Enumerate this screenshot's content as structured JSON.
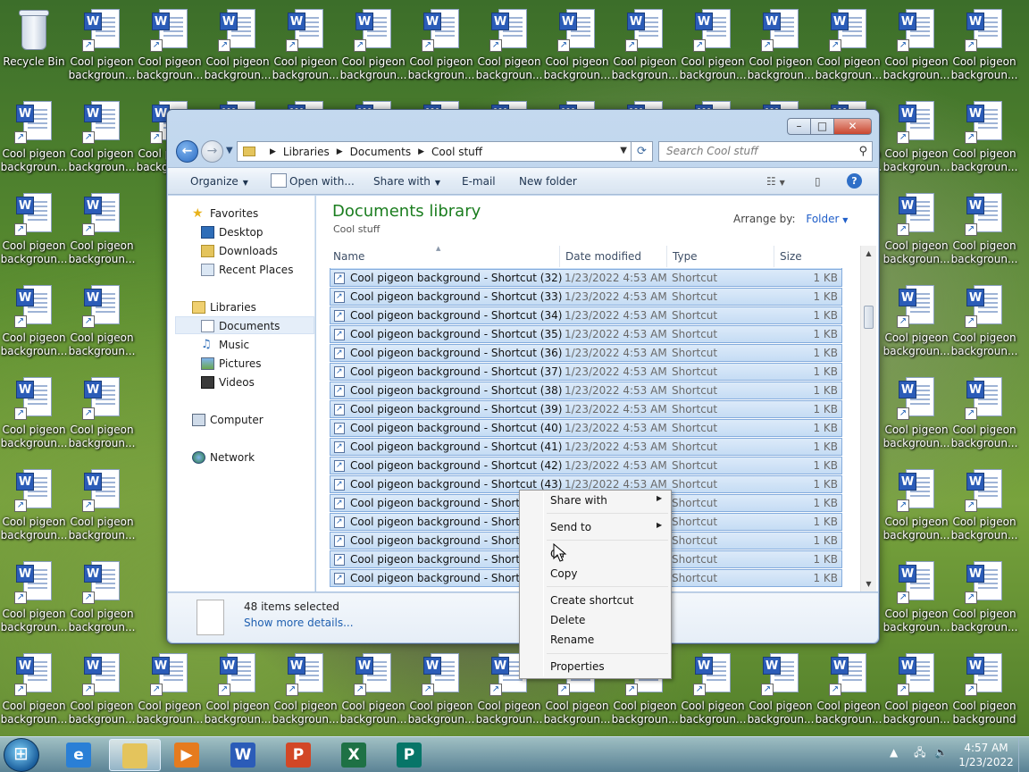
{
  "desktop": {
    "recycle_bin_label": "Recycle Bin",
    "icon_label_line1": "Cool pigeon",
    "icon_label_line2": "backgroun...",
    "last_icon_line2": "background"
  },
  "window": {
    "breadcrumb": [
      "Libraries",
      "Documents",
      "Cool stuff"
    ],
    "search_placeholder": "Search Cool stuff",
    "toolbar": {
      "organize": "Organize",
      "open_with": "Open with...",
      "share_with": "Share with",
      "email": "E-mail",
      "new_folder": "New folder"
    },
    "nav": {
      "favorites": "Favorites",
      "desktop": "Desktop",
      "downloads": "Downloads",
      "recent_places": "Recent Places",
      "libraries": "Libraries",
      "documents": "Documents",
      "music": "Music",
      "pictures": "Pictures",
      "videos": "Videos",
      "computer": "Computer",
      "network": "Network"
    },
    "library_title": "Documents library",
    "library_subtitle": "Cool stuff",
    "arrange_by_label": "Arrange by:",
    "arrange_by_value": "Folder",
    "columns": {
      "name": "Name",
      "date": "Date modified",
      "type": "Type",
      "size": "Size"
    },
    "files": [
      {
        "name": "Cool pigeon background - Shortcut (32)",
        "date": "1/23/2022 4:53 AM",
        "type": "Shortcut",
        "size": "1 KB"
      },
      {
        "name": "Cool pigeon background - Shortcut (33)",
        "date": "1/23/2022 4:53 AM",
        "type": "Shortcut",
        "size": "1 KB"
      },
      {
        "name": "Cool pigeon background - Shortcut (34)",
        "date": "1/23/2022 4:53 AM",
        "type": "Shortcut",
        "size": "1 KB"
      },
      {
        "name": "Cool pigeon background - Shortcut (35)",
        "date": "1/23/2022 4:53 AM",
        "type": "Shortcut",
        "size": "1 KB"
      },
      {
        "name": "Cool pigeon background - Shortcut (36)",
        "date": "1/23/2022 4:53 AM",
        "type": "Shortcut",
        "size": "1 KB"
      },
      {
        "name": "Cool pigeon background - Shortcut (37)",
        "date": "1/23/2022 4:53 AM",
        "type": "Shortcut",
        "size": "1 KB"
      },
      {
        "name": "Cool pigeon background - Shortcut (38)",
        "date": "1/23/2022 4:53 AM",
        "type": "Shortcut",
        "size": "1 KB"
      },
      {
        "name": "Cool pigeon background - Shortcut (39)",
        "date": "1/23/2022 4:53 AM",
        "type": "Shortcut",
        "size": "1 KB"
      },
      {
        "name": "Cool pigeon background - Shortcut (40)",
        "date": "1/23/2022 4:53 AM",
        "type": "Shortcut",
        "size": "1 KB"
      },
      {
        "name": "Cool pigeon background - Shortcut (41)",
        "date": "1/23/2022 4:53 AM",
        "type": "Shortcut",
        "size": "1 KB"
      },
      {
        "name": "Cool pigeon background - Shortcut (42)",
        "date": "1/23/2022 4:53 AM",
        "type": "Shortcut",
        "size": "1 KB"
      },
      {
        "name": "Cool pigeon background - Shortcut (43)",
        "date": "1/23/2022 4:53 AM",
        "type": "Shortcut",
        "size": "1 KB"
      },
      {
        "name": "Cool pigeon background - Shortcut",
        "date": "",
        "type": "Shortcut",
        "size": "1 KB"
      },
      {
        "name": "Cool pigeon background - Shortcut",
        "date": "",
        "type": "Shortcut",
        "size": "1 KB"
      },
      {
        "name": "Cool pigeon background - Shortcut",
        "date": "",
        "type": "Shortcut",
        "size": "1 KB"
      },
      {
        "name": "Cool pigeon background - Shortcut",
        "date": "",
        "type": "Shortcut",
        "size": "1 KB"
      },
      {
        "name": "Cool pigeon background - Shortcut",
        "date": "",
        "type": "Shortcut",
        "size": "1 KB"
      }
    ],
    "selection_count": "48 items selected",
    "show_more_details": "Show more details..."
  },
  "context_menu": {
    "share_with": "Share with",
    "send_to": "Send to",
    "cut": "Cu",
    "copy": "Copy",
    "create_shortcut": "Create shortcut",
    "delete": "Delete",
    "rename": "Rename",
    "properties": "Properties"
  },
  "taskbar": {
    "time": "4:57 AM",
    "date": "1/23/2022",
    "apps": [
      {
        "icon": "internet-explorer-icon",
        "glyph": "e",
        "color": "#2a7fd6"
      },
      {
        "icon": "windows-explorer-icon",
        "glyph": "",
        "color": "#e4c45c"
      },
      {
        "icon": "media-player-icon",
        "glyph": "▶",
        "color": "#e57b1e"
      },
      {
        "icon": "word-icon",
        "glyph": "W",
        "color": "#2b5cb8"
      },
      {
        "icon": "powerpoint-icon",
        "glyph": "P",
        "color": "#d24726"
      },
      {
        "icon": "excel-icon",
        "glyph": "X",
        "color": "#1e7145"
      },
      {
        "icon": "publisher-icon",
        "glyph": "P",
        "color": "#077568"
      }
    ]
  }
}
